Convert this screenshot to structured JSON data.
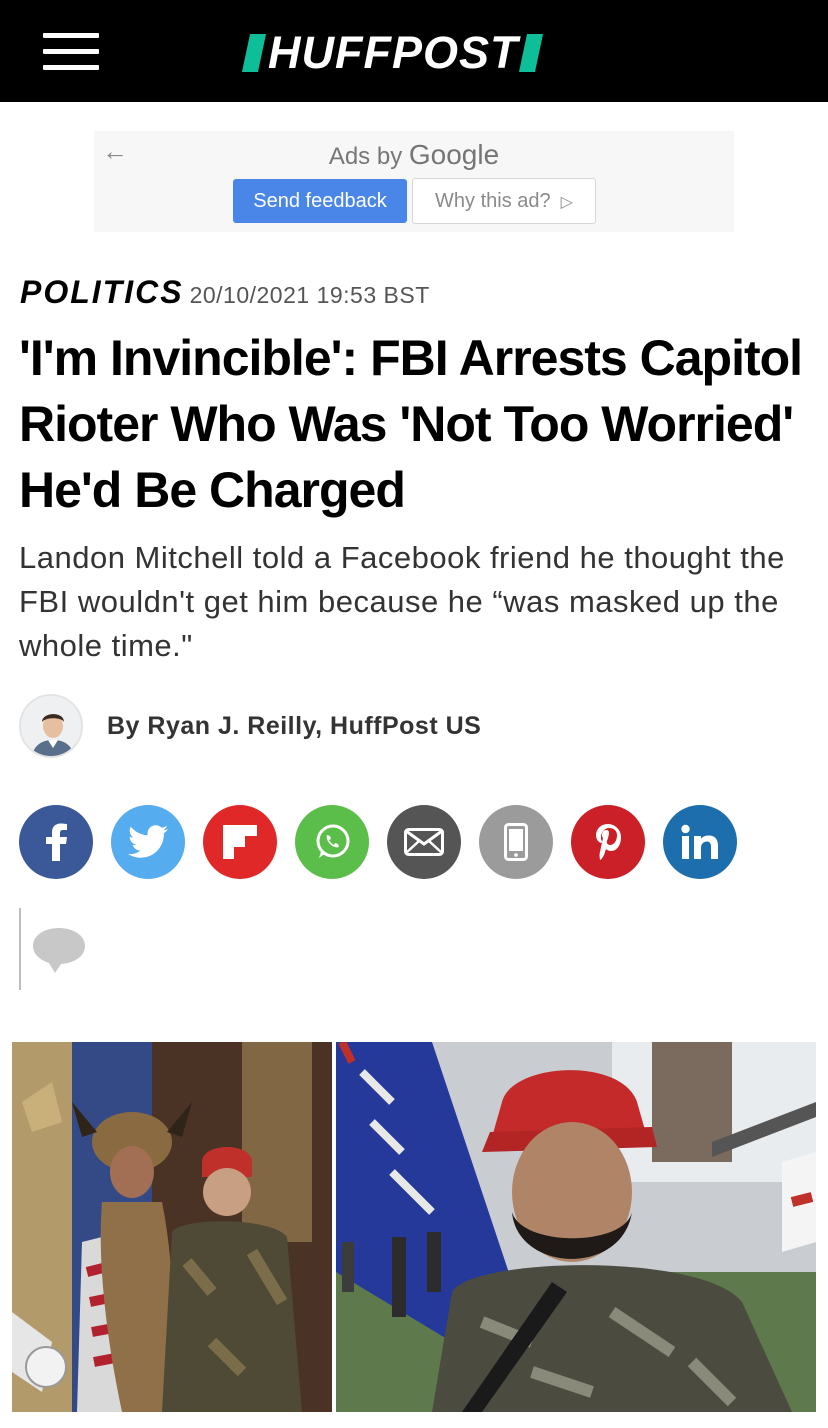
{
  "header": {
    "brand": "HUFFPOST",
    "menu_icon": "hamburger-menu-icon",
    "background": "#000000",
    "accent": "#0dbe98"
  },
  "ad": {
    "ads_by": "Ads by",
    "ads_brand": "Google",
    "back_icon": "arrow-left-icon",
    "send_feedback": "Send feedback",
    "why_this_ad": "Why this ad?",
    "why_icon": "play-outline-icon",
    "feedback_color": "#4a86e8"
  },
  "article": {
    "section": "POLITICS",
    "date": "20/10/2021 19:53 BST",
    "headline": "'I'm Invincible': FBI Arrests Capitol Rioter Who Was 'Not Too Worried' He'd Be Charged",
    "dek": "Landon Mitchell told a Facebook friend he thought the FBI wouldn't get him because he “was masked up the whole time.\"",
    "byline": "By Ryan J. Reilly, HuffPost US"
  },
  "share": [
    {
      "network": "facebook",
      "icon": "facebook-icon",
      "color": "#3b5998"
    },
    {
      "network": "twitter",
      "icon": "twitter-icon",
      "color": "#55acee"
    },
    {
      "network": "flipboard",
      "icon": "flipboard-icon",
      "color": "#e12828"
    },
    {
      "network": "whatsapp",
      "icon": "whatsapp-icon",
      "color": "#5cbe4a"
    },
    {
      "network": "email",
      "icon": "mail-icon",
      "color": "#555555"
    },
    {
      "network": "sms",
      "icon": "phone-icon",
      "color": "#9b9b9b"
    },
    {
      "network": "pinterest",
      "icon": "pinterest-icon",
      "color": "#cb2027"
    },
    {
      "network": "linkedin",
      "icon": "linkedin-icon",
      "color": "#1c6ead"
    }
  ],
  "comments": {
    "icon": "comment-bubble-icon"
  },
  "lead_image": {
    "caption_visible": false
  }
}
